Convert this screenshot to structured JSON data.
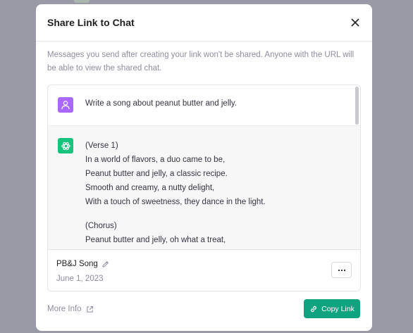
{
  "modal": {
    "title": "Share Link to Chat",
    "notice": "Messages you send after creating your link won't be shared. Anyone with the URL will be able to view the shared chat."
  },
  "conversation": {
    "user_message": "Write a song about peanut butter and jelly.",
    "assistant_lines": [
      "(Verse 1)",
      "In a world of flavors, a duo came to be,",
      "Peanut butter and jelly, a classic recipe.",
      "Smooth and creamy, a nutty delight,",
      "With a touch of sweetness, they dance in the light.",
      "",
      "(Chorus)",
      "Peanut butter and jelly, oh what a treat,"
    ]
  },
  "chat": {
    "title": "PB&J Song",
    "date": "June 1, 2023"
  },
  "footer": {
    "more_info_label": "More Info",
    "copy_label": "Copy Link"
  },
  "colors": {
    "accent": "#10a37f",
    "user_avatar": "#ab68ff",
    "assistant_avatar": "#19c37d"
  },
  "icons": [
    "close-icon",
    "user-icon",
    "openai-icon",
    "pencil-icon",
    "more-icon",
    "external-link-icon",
    "link-icon"
  ]
}
